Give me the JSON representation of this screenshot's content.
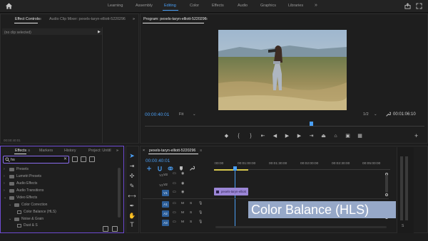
{
  "workspace_tabs": [
    {
      "label": "Learning",
      "active": false
    },
    {
      "label": "Assembly",
      "active": false
    },
    {
      "label": "Editing",
      "active": true
    },
    {
      "label": "Color",
      "active": false
    },
    {
      "label": "Effects",
      "active": false
    },
    {
      "label": "Audio",
      "active": false
    },
    {
      "label": "Graphics",
      "active": false
    },
    {
      "label": "Libraries",
      "active": false
    }
  ],
  "workspace_more": "»",
  "effect_controls": {
    "tabs": [
      "Effect Controls",
      "Audio Clip Mixer: pexels-taryn-elliott-5220296"
    ],
    "tab_menu": "≡",
    "overflow": "»",
    "no_clip": "(no clip selected)",
    "footer_time": "00:00:40:01"
  },
  "program_monitor": {
    "title": "Program: pexels-taryn-elliott-5220296",
    "title_menu": "≡",
    "timecode": "00:00:40:01",
    "fit_label": "Fit",
    "resolution": "1/2",
    "duration": "00:01:06:10",
    "playhead_fraction": 0.59
  },
  "effects_panel": {
    "tabs": [
      "Effects",
      "Markers",
      "History",
      "Project: Untitl"
    ],
    "tab_menu": "≡",
    "overflow": "»",
    "search_value": "hs",
    "tree": [
      {
        "label": "Presets",
        "indent": 0,
        "type": "folder"
      },
      {
        "label": "Lumetri Presets",
        "indent": 0,
        "type": "folder"
      },
      {
        "label": "Audio Effects",
        "indent": 0,
        "type": "folder"
      },
      {
        "label": "Audio Transitions",
        "indent": 0,
        "type": "folder"
      },
      {
        "label": "Video Effects",
        "indent": 0,
        "type": "folder",
        "expanded": true
      },
      {
        "label": "Color Correction",
        "indent": 1,
        "type": "folder",
        "expanded": true
      },
      {
        "label": "Color Balance (HLS)",
        "indent": 2,
        "type": "effect"
      },
      {
        "label": "Noise & Grain",
        "indent": 1,
        "type": "folder",
        "expanded": true
      },
      {
        "label": "Dust & S",
        "indent": 2,
        "type": "effect"
      }
    ]
  },
  "timeline": {
    "sequence_name": "pexels-taryn-elliott-5220296",
    "tab_menu": "≡",
    "close": "×",
    "timecode": "00:00:40:01",
    "ruler_labels": [
      ":00:00",
      "00:01:00:00",
      "00:01:30:00",
      "00:02:00:00",
      "00:02:30:00",
      "00:03:00:00",
      "00:05:00:00"
    ],
    "video_tracks": [
      {
        "target": "V3",
        "name": "V3"
      },
      {
        "target": "V2",
        "name": "V2"
      },
      {
        "target": "V1",
        "name": "V1",
        "active": true
      }
    ],
    "audio_tracks": [
      {
        "target": "A1",
        "name": "A1",
        "active": true
      },
      {
        "target": "A2",
        "name": "A2",
        "active": true
      },
      {
        "target": "A3",
        "name": "A3",
        "active": true
      }
    ],
    "track_m": "M",
    "track_s": "S",
    "clip_label": "pexels-taryn-elliott"
  },
  "caption": "Color Balance (HLS)",
  "meter_label": "S",
  "colors": {
    "accent": "#4a9ff5",
    "clip": "#9b86d6",
    "effects_border": "#6e4bd2"
  }
}
